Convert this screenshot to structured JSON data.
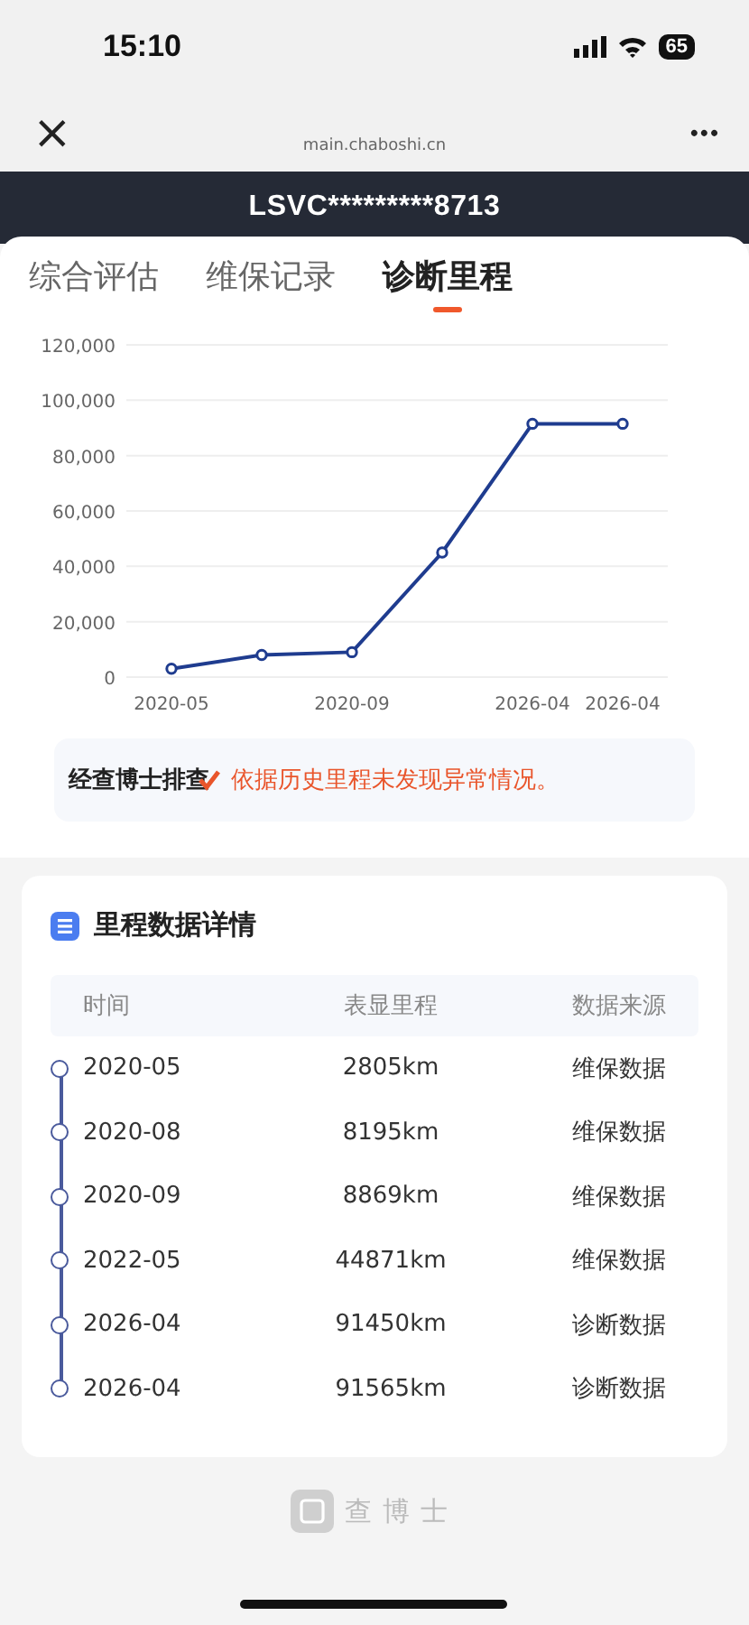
{
  "status_bar": {
    "time": "15:10",
    "battery": "65"
  },
  "nav": {
    "close": "×",
    "url": "main.chaboshi.cn",
    "more": "•••"
  },
  "vin": "LSVC*********8713",
  "tabs": [
    {
      "label": "综合评估",
      "selected": false
    },
    {
      "label": "维保记录",
      "selected": false
    },
    {
      "label": "诊断里程",
      "selected": true
    }
  ],
  "chart": {
    "chart_data": {
      "type": "line",
      "categories": [
        "2020-05",
        null,
        "2020-09",
        null,
        "2026-04",
        "2026-04"
      ],
      "grid": true,
      "series": [
        {
          "color": "#1f3c8f",
          "marker": "circle",
          "values": [
            3000,
            8000,
            9000,
            45000,
            91500,
            91500
          ]
        }
      ],
      "ylim": [
        0,
        120000
      ],
      "yticks": [
        {
          "value": 0,
          "label": "0"
        },
        {
          "value": 20000,
          "label": "20,000"
        },
        {
          "value": 40000,
          "label": "40,000"
        },
        {
          "value": 60000,
          "label": "60,000"
        },
        {
          "value": 80000,
          "label": "80,000"
        },
        {
          "value": 100000,
          "label": "100,000"
        },
        {
          "value": 120000,
          "label": "120,000"
        }
      ]
    }
  },
  "verdict": {
    "source": "经查博士排查",
    "message": "依据历史里程未发现异常情况。"
  },
  "details": {
    "title": "里程数据详情",
    "columns": [
      "时间",
      "表显里程",
      "数据来源"
    ],
    "rows": [
      {
        "time": "2020-05",
        "mileage": "2805km",
        "source": "维保数据"
      },
      {
        "time": "2020-08",
        "mileage": "8195km",
        "source": "维保数据"
      },
      {
        "time": "2020-09",
        "mileage": "8869km",
        "source": "维保数据"
      },
      {
        "time": "2022-05",
        "mileage": "44871km",
        "source": "维保数据"
      },
      {
        "time": "2026-04",
        "mileage": "91450km",
        "source": "诊断数据"
      },
      {
        "time": "2026-04",
        "mileage": "91565km",
        "source": "诊断数据"
      }
    ]
  },
  "footer": {
    "brand": "查博士"
  }
}
